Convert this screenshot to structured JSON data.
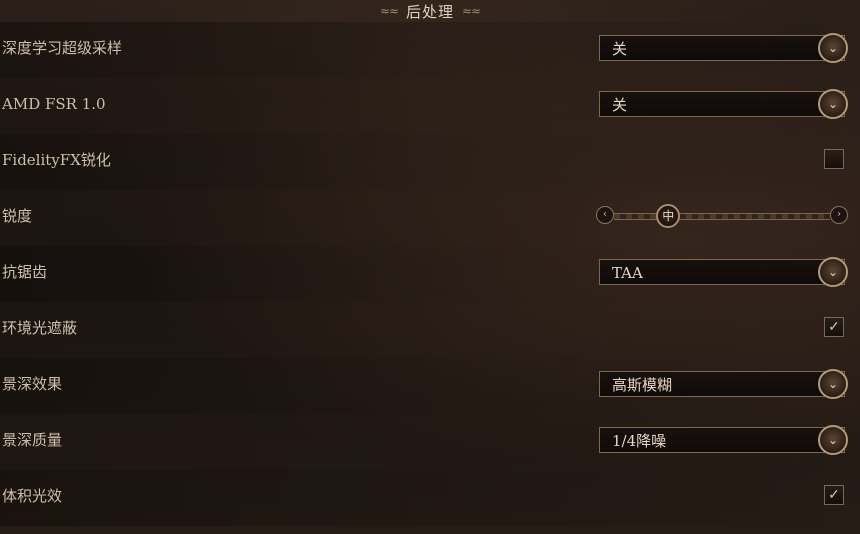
{
  "header": {
    "title": "后处理",
    "flourish_left": "≈≈",
    "flourish_right": "≈≈"
  },
  "settings": [
    {
      "label": "深度学习超级采样",
      "type": "dropdown",
      "value": "关"
    },
    {
      "label": "AMD FSR 1.0",
      "type": "dropdown",
      "value": "关"
    },
    {
      "label": "FidelityFX锐化",
      "type": "checkbox",
      "checked": false
    },
    {
      "label": "锐度",
      "type": "slider",
      "value_label": "中",
      "level": 0.22
    },
    {
      "label": "抗锯齿",
      "type": "dropdown",
      "value": "TAA"
    },
    {
      "label": "环境光遮蔽",
      "type": "checkbox",
      "checked": true
    },
    {
      "label": "景深效果",
      "type": "dropdown",
      "value": "高斯模糊"
    },
    {
      "label": "景深质量",
      "type": "dropdown",
      "value": "1/4降噪"
    },
    {
      "label": "体积光效",
      "type": "checkbox",
      "checked": true
    }
  ],
  "icons": {
    "dropdown": "chevron-down-icon",
    "check": "checkmark-icon",
    "slider_left": "chevron-left-icon",
    "slider_right": "chevron-right-icon"
  },
  "glyphs": {
    "chevron_down": "⌄",
    "check": "✓",
    "left": "‹",
    "right": "›"
  },
  "colors": {
    "accent": "#b39a74",
    "text": "#d6c9b6",
    "background": "#221914"
  }
}
